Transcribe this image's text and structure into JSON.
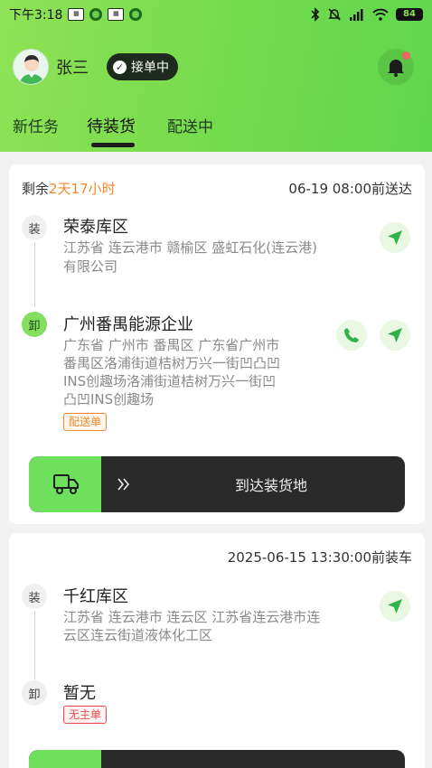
{
  "status_bar": {
    "time": "下午3:18",
    "battery": "84"
  },
  "user": {
    "name": "张三",
    "status": "接单中"
  },
  "tabs": [
    {
      "label": "新任务",
      "active": false
    },
    {
      "label": "待装货",
      "active": true
    },
    {
      "label": "配送中",
      "active": false
    }
  ],
  "orders": [
    {
      "remain_prefix": "剩余",
      "remain_value": "2天17小时",
      "deadline": "06-19 08:00前送达",
      "load": {
        "badge": "装",
        "name": "荣泰库区",
        "address_line1": "江苏省 连云港市 赣榆区 盛虹石化(连云港)",
        "address_line2": "有限公司"
      },
      "unload": {
        "badge": "卸",
        "name": "广州番禺能源企业",
        "address_line1": "广东省 广州市 番禺区 广东省广州市",
        "address_line2": "番禺区洛浦街道桔树万兴一街凹凸凹",
        "address_line3": "INS创趣场洛浦街道桔树万兴一街凹",
        "address_line4": "凸凹INS创趣场",
        "tag": "配送单"
      },
      "action": "到达装货地"
    },
    {
      "deadline": "2025-06-15 13:30:00前装车",
      "load": {
        "badge": "装",
        "name": "千红库区",
        "address_line1": "江苏省 连云港市 连云区 江苏省连云港市连",
        "address_line2": "云区连云街道液体化工区"
      },
      "unload": {
        "badge": "卸",
        "name": "暂无",
        "tag": "无主单"
      }
    }
  ],
  "colors": {
    "accent_green": "#6ee05c",
    "remain_orange": "#f0892e",
    "tag_red": "#ea4a4a",
    "slider_dark": "#2a2a2a"
  }
}
